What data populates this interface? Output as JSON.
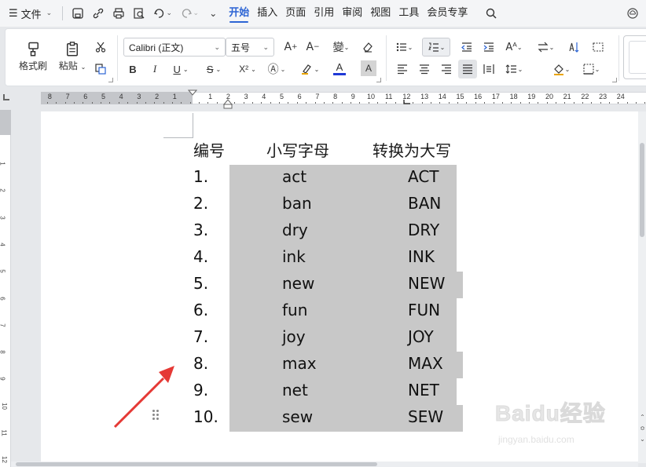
{
  "menubar": {
    "file_label": "文件",
    "tabs": [
      {
        "label": "开始",
        "active": true
      },
      {
        "label": "插入",
        "active": false
      },
      {
        "label": "页面",
        "active": false
      },
      {
        "label": "引用",
        "active": false
      },
      {
        "label": "审阅",
        "active": false
      },
      {
        "label": "视图",
        "active": false
      },
      {
        "label": "工具",
        "active": false
      },
      {
        "label": "会员专享",
        "active": false
      }
    ],
    "accent_color": "#2c64d4"
  },
  "ribbon": {
    "format_painter_label": "格式刷",
    "paste_label": "粘贴",
    "font_name": "Calibri (正文)",
    "font_size": "五号",
    "bold": "B",
    "italic": "I",
    "underline": "U",
    "strikethrough": "S",
    "superscript": "X²",
    "font_color_letter": "A",
    "char_shading_letter": "A",
    "font_color": "#1f39d6"
  },
  "ruler": {
    "numbers_left": [
      "8",
      "7",
      "6",
      "5",
      "4",
      "3",
      "2",
      "1"
    ],
    "numbers_right": [
      "1",
      "2",
      "3",
      "4",
      "5",
      "6",
      "7",
      "8",
      "9",
      "10",
      "11",
      "12",
      "13",
      "14",
      "15",
      "16",
      "17",
      "18",
      "19",
      "20",
      "21",
      "22",
      "23",
      "24"
    ],
    "vertical_numbers": [
      "1",
      "2",
      "3",
      "4",
      "5",
      "6",
      "7",
      "8",
      "9",
      "10",
      "11",
      "12"
    ]
  },
  "document": {
    "headers": {
      "number": "编号",
      "lowercase": "小写字母",
      "uppercase": "转换为大写"
    },
    "rows": [
      {
        "num": "1.",
        "lower": "act",
        "upper": "ACT"
      },
      {
        "num": "2.",
        "lower": "ban",
        "upper": "BAN"
      },
      {
        "num": "3.",
        "lower": "dry",
        "upper": "DRY"
      },
      {
        "num": "4.",
        "lower": "ink",
        "upper": "INK"
      },
      {
        "num": "5.",
        "lower": "new",
        "upper": "NEW"
      },
      {
        "num": "6.",
        "lower": "fun",
        "upper": "FUN"
      },
      {
        "num": "7.",
        "lower": "joy",
        "upper": "JOY"
      },
      {
        "num": "8.",
        "lower": "max",
        "upper": "MAX"
      },
      {
        "num": "9.",
        "lower": "net",
        "upper": "NET"
      },
      {
        "num": "10.",
        "lower": "sew",
        "upper": "SEW"
      }
    ],
    "selection_color": "#c8c8c8",
    "arrow_color": "#e53935"
  },
  "watermark": {
    "logo_text": "Baidu经验",
    "url_text": "jingyan.baidu.com"
  }
}
